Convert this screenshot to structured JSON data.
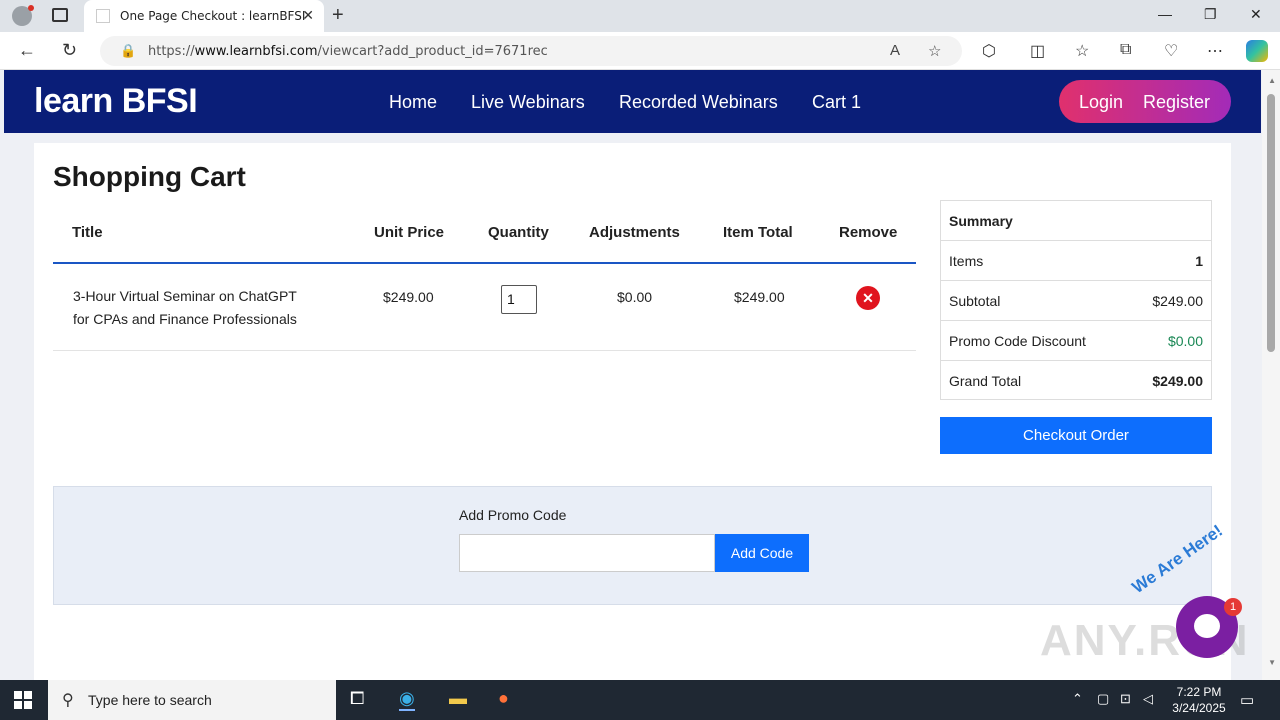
{
  "browser": {
    "tab_title": "One Page Checkout : learnBFSI",
    "tab_close": "✕",
    "new_tab": "+",
    "url_prefix": "https://",
    "url_domain": "www.learnbfsi.com",
    "url_path": "/viewcart?add_product_id=7671rec",
    "minimize": "—",
    "restore": "❐",
    "close": "✕"
  },
  "site": {
    "logo": "learn BFSI",
    "nav": [
      "Home",
      "Live Webinars",
      "Recorded Webinars",
      "Cart 1"
    ],
    "login": "Login",
    "register": "Register"
  },
  "cart": {
    "heading": "Shopping Cart",
    "columns": [
      "Title",
      "Unit Price",
      "Quantity",
      "Adjustments",
      "Item Total",
      "Remove"
    ],
    "items": [
      {
        "title_line1": "3-Hour Virtual Seminar on ChatGPT",
        "title_line2": "for CPAs and Finance Professionals",
        "unit_price": "$249.00",
        "quantity": "1",
        "adjustments": "$0.00",
        "item_total": "$249.00"
      }
    ]
  },
  "summary": {
    "heading": "Summary",
    "items_label": "Items",
    "items_value": "1",
    "subtotal_label": "Subtotal",
    "subtotal_value": "$249.00",
    "discount_label": "Promo Code Discount",
    "discount_value": "$0.00",
    "grand_total_label": "Grand Total",
    "grand_total_value": "$249.00",
    "checkout_label": "Checkout Order",
    "discount_color": "#198754"
  },
  "promo": {
    "label": "Add Promo Code",
    "input_value": "",
    "button_label": "Add Code"
  },
  "chat": {
    "tagline": "We Are Here!",
    "badge": "1"
  },
  "watermark": "ANY.RUN",
  "taskbar": {
    "search_placeholder": "Type here to search",
    "time": "7:22 PM",
    "date": "3/24/2025"
  },
  "colors": {
    "header_bg": "#0a1e78",
    "accent_blue": "#0d6efd",
    "remove_red": "#e0141e"
  }
}
